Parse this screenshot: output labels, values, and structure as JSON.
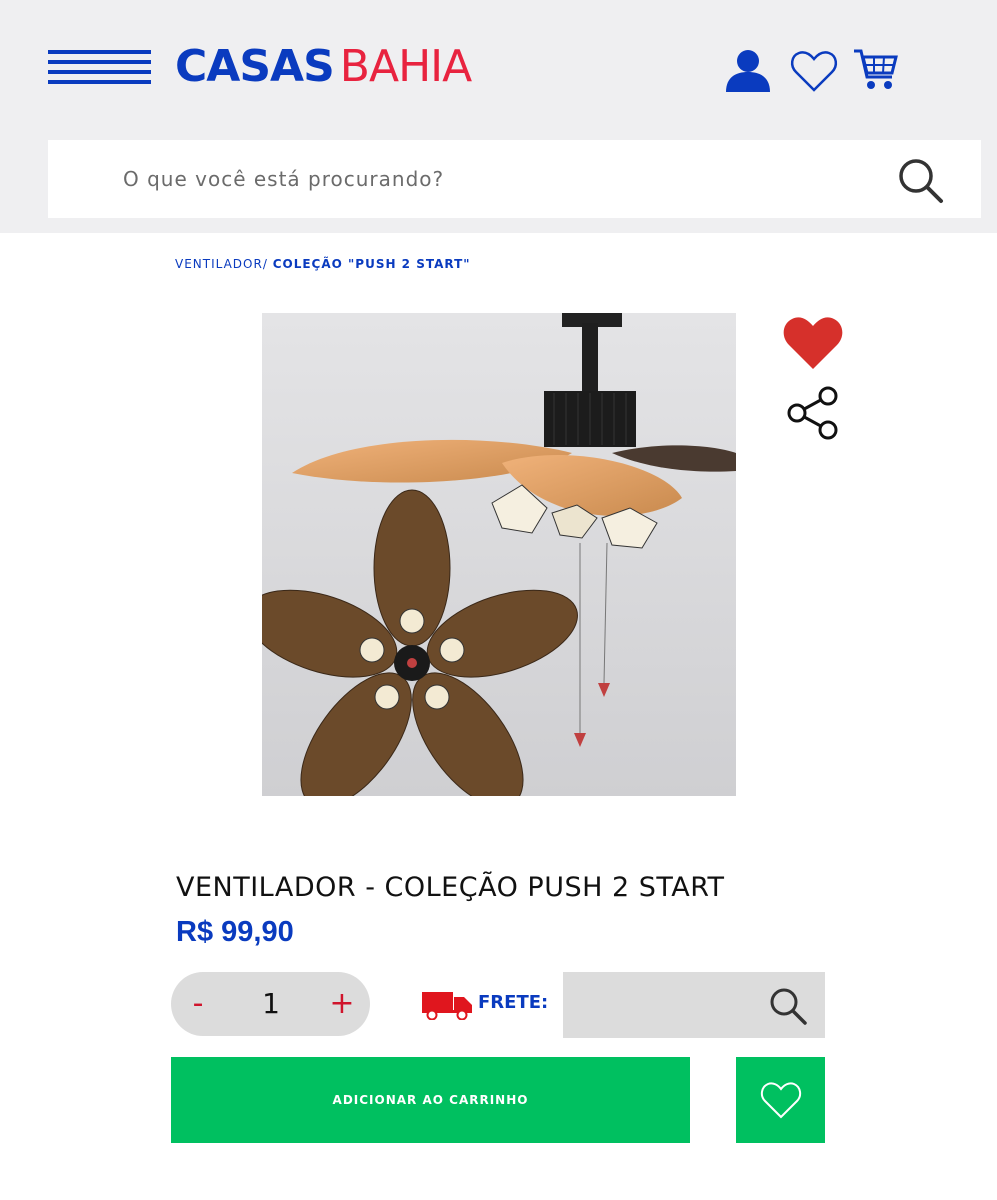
{
  "header": {
    "logo_part1": "CASAS",
    "logo_part2": "BAHIA",
    "icons": [
      "menu-icon",
      "user-icon",
      "heart-outline-icon",
      "cart-icon"
    ],
    "brand_blue": "#0a3bbf",
    "brand_red": "#e8233f"
  },
  "search": {
    "placeholder": "O que você está procurando?"
  },
  "breadcrumb": {
    "parent": "VENTILADOR/",
    "current": "COLEÇÃO \"PUSH 2 START\""
  },
  "product": {
    "title": "VENTILADOR - COLEÇÃO PUSH 2 START",
    "price": "R$ 99,90",
    "image_icon": "ceiling-fan-image"
  },
  "quantity": {
    "minus_label": "-",
    "value": "1",
    "plus_label": "+"
  },
  "shipping": {
    "label": "FRETE:",
    "icon": "truck-icon"
  },
  "actions": {
    "add_to_cart_label": "ADICIONAR AO CARRINHO",
    "accent_green": "#00c060",
    "favorite_red": "#d6302b"
  }
}
